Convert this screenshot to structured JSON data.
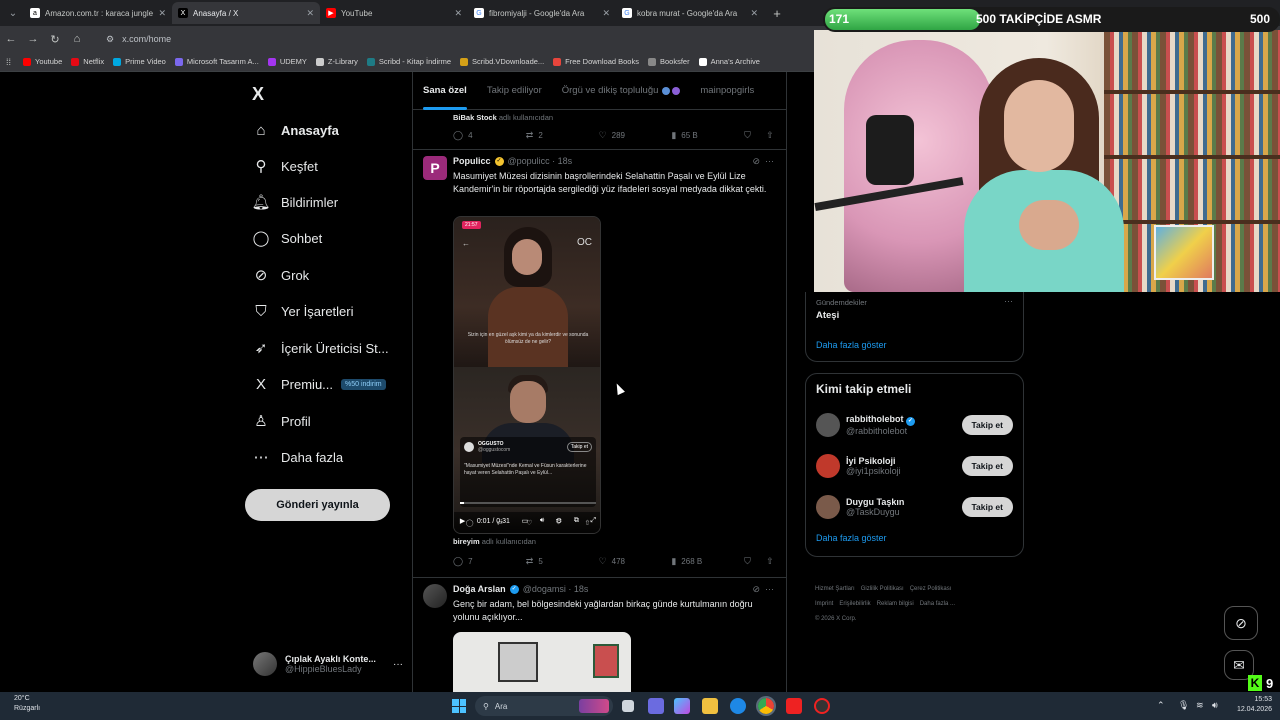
{
  "browser": {
    "tabs": [
      {
        "title": "Amazon.com.tr : karaca jungle",
        "fav": "a",
        "color": "#ffffff",
        "fg": "#000"
      },
      {
        "title": "Anasayfa / X",
        "fav": "X",
        "color": "#000000",
        "fg": "#fff",
        "active": true
      },
      {
        "title": "YouTube",
        "fav": "▶",
        "color": "#ff0000",
        "fg": "#fff"
      },
      {
        "title": "fibromiyalji - Google'da Ara",
        "fav": "G",
        "color": "#ffffff",
        "fg": "#4285f4"
      },
      {
        "title": "kobra murat - Google'da Ara",
        "fav": "G",
        "color": "#ffffff",
        "fg": "#4285f4"
      }
    ],
    "url": "x.com/home",
    "bookmarks": [
      {
        "label": "Youtube",
        "color": "#ff0000"
      },
      {
        "label": "Netflix",
        "color": "#e50914"
      },
      {
        "label": "Prime Video",
        "color": "#00a8e1"
      },
      {
        "label": "Microsoft Tasarım A...",
        "color": "#7b68ee"
      },
      {
        "label": "UDEMY",
        "color": "#a435f0"
      },
      {
        "label": "Z-Library",
        "color": "#cccccc"
      },
      {
        "label": "Scribd - Kitap İndirme",
        "color": "#1e7b85"
      },
      {
        "label": "Scribd.VDownloade...",
        "color": "#d4a017"
      },
      {
        "label": "Free Download Books",
        "color": "#e8453c"
      },
      {
        "label": "Booksfer",
        "color": "#888888"
      },
      {
        "label": "Anna's Archive",
        "color": "#ffffff"
      }
    ]
  },
  "sidebar": {
    "logo": "X",
    "items": [
      {
        "label": "Anasayfa",
        "icon": "home-icon",
        "glyph": "⌂",
        "bold": true
      },
      {
        "label": "Keşfet",
        "icon": "search-icon",
        "glyph": "⚲"
      },
      {
        "label": "Bildirimler",
        "icon": "bell-icon",
        "glyph": "🔔︎"
      },
      {
        "label": "Sohbet",
        "icon": "chat-icon",
        "glyph": "◯"
      },
      {
        "label": "Grok",
        "icon": "grok-icon",
        "glyph": "⊘"
      },
      {
        "label": "Yer İşaretleri",
        "icon": "bookmark-icon",
        "glyph": "⛉"
      },
      {
        "label": "İçerik Üreticisi St...",
        "icon": "rocket-icon",
        "glyph": "➶"
      },
      {
        "label": "Premiu...",
        "icon": "x-premium-icon",
        "glyph": "X",
        "badge": "%50 indirim"
      },
      {
        "label": "Profil",
        "icon": "profile-icon",
        "glyph": "♙"
      },
      {
        "label": "Daha fazla",
        "icon": "more-circle-icon",
        "glyph": "⋯"
      }
    ],
    "post_button": "Gönderi yayınla",
    "account": {
      "name": "Çıplak Ayaklı Konte...",
      "handle": "@HippieBluesLady"
    }
  },
  "feed": {
    "tabs": [
      "Sana özel",
      "Takip ediliyor",
      "Örgü ve dikiş topluluğu",
      "mainpopgirls"
    ],
    "prev_tweet": {
      "from_name": "BiBak Stock",
      "from_suffix": " adlı kullanıcıdan",
      "replies": "4",
      "retweets": "2",
      "likes": "289",
      "views": "65 B"
    },
    "tweet1": {
      "name": "Populicc",
      "handle": "@populicc · 18s",
      "text": "Masumiyet Müzesi dizisinin başrollerindeki Selahattin Paşalı ve Eylül Lize Kandemir'in bir röportajda sergilediği yüz ifadeleri sosyal medyada dikkat çekti.",
      "video": {
        "caption_top": "Sizin için en güzel aşk kimi ya da kimlerdir ve sonunda ölümsüz de ne gelir?",
        "account": "OGGUSTO",
        "account_handle": "@oggustocom",
        "follow": "Takip et",
        "desc": "\"Masumiyet Müzesi\"nde Kemal ve Füsun karakterlerine hayat veren Selahattin Paşalı ve Eylül...",
        "time": "0:01 / 0:31",
        "progress": 0.03
      },
      "from_name": "bireyim",
      "from_suffix": " adlı kullanıcıdan",
      "replies": "7",
      "retweets": "5",
      "likes": "478",
      "views": "268 B"
    },
    "tweet2": {
      "name": "Doğa Arslan",
      "handle": "@dogamsi · 18s",
      "text": "Genç bir adam, bel bölgesindeki yağlardan birkaç günde kurtulmanın doğru yolunu açıklıyor..."
    }
  },
  "right": {
    "trend": {
      "meta": "Gündemdekiler",
      "title": "Ateşi",
      "show_more": "Daha fazla göster"
    },
    "who_to_follow": {
      "title": "Kimi takip etmeli",
      "users": [
        {
          "name": "rabbitholebot",
          "handle": "@rabbitholebot",
          "verified": true,
          "color": "#555555"
        },
        {
          "name": "İyi Psikoloji",
          "handle": "@iyi1psikoloji",
          "verified": false,
          "color": "#c0392b"
        },
        {
          "name": "Duygu Taşkın",
          "handle": "@TaskDuygu",
          "verified": false,
          "color": "#7a5a4a"
        }
      ],
      "follow_label": "Takip et",
      "show_more": "Daha fazla göster"
    },
    "footer": [
      "Hizmet Şartları",
      "Gizlilik Politikası",
      "Çerez Politikası",
      "Imprint",
      "Erişilebilirlik",
      "Reklam bilgisi",
      "Daha fazla ...",
      "© 2026 X Corp."
    ]
  },
  "stream_overlay": {
    "left": "171",
    "title": "500 TAKİPÇİDE ASMR",
    "right": "500",
    "progress": 0.342,
    "kick_count": "9"
  },
  "taskbar": {
    "temp": "20°C",
    "weather": "Rüzgarlı",
    "search": "Ara",
    "time": "15:53",
    "date": "12.04.2026"
  },
  "colors": {
    "accent": "#1d9bf0",
    "verified": "#f4c430",
    "blue_verified": "#1d9bf0",
    "kick": "#53fc18"
  }
}
